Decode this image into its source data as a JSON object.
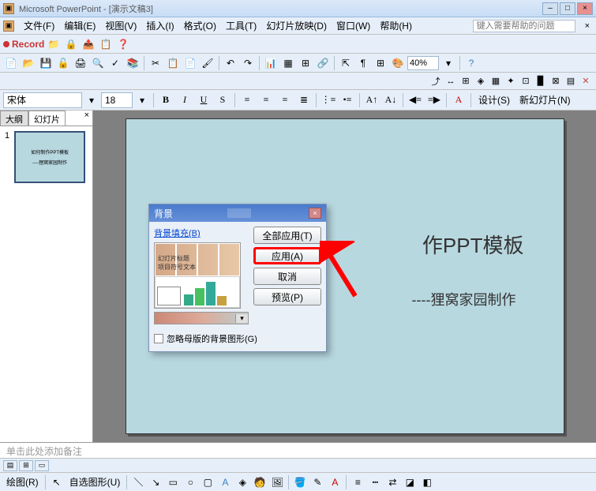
{
  "title": "Microsoft PowerPoint - [演示文稿3]",
  "menubar": {
    "file": "文件(F)",
    "edit": "编辑(E)",
    "view": "视图(V)",
    "insert": "插入(I)",
    "format": "格式(O)",
    "tools": "工具(T)",
    "slideshow": "幻灯片放映(D)",
    "window": "窗口(W)",
    "help": "帮助(H)",
    "help_placeholder": "键入需要帮助的问题"
  },
  "toolbar": {
    "record": "Record",
    "zoom": "40%"
  },
  "format": {
    "font": "宋体",
    "size": "18",
    "design": "设计(S)",
    "new_slide": "新幻灯片(N)"
  },
  "outline": {
    "tab_outline": "大纲",
    "tab_slides": "幻灯片",
    "slide_num": "1",
    "thumb_title": "如何制作PPT模板",
    "thumb_sub": "----狸窝家园制作"
  },
  "slide": {
    "title_partial": "作PPT模板",
    "subtitle": "----狸窝家园制作"
  },
  "dialog": {
    "title": "背景",
    "fill_label": "背景填充(B)",
    "preview_text1": "幻灯片标题",
    "preview_text2": "项目符号文本",
    "apply_all": "全部应用(T)",
    "apply": "应用(A)",
    "cancel": "取消",
    "preview": "预览(P)",
    "ignore_master": "忽略母版的背景图形(G)"
  },
  "notes": "单击此处添加备注",
  "drawbar": {
    "draw": "绘图(R)",
    "autoshape": "自选图形(U)"
  }
}
